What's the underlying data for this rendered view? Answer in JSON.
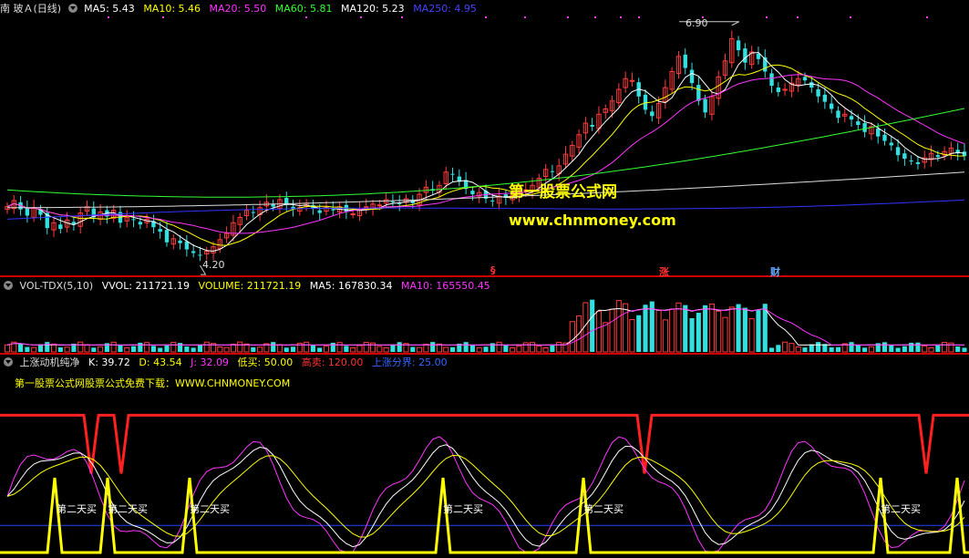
{
  "main_header": {
    "title": "南 玻Ａ(日线)",
    "ma": [
      {
        "label": "MA5: 5.43",
        "color": "#ffffff"
      },
      {
        "label": "MA10: 5.46",
        "color": "#ffff00"
      },
      {
        "label": "MA20: 5.50",
        "color": "#ff33ff"
      },
      {
        "label": "MA60: 5.81",
        "color": "#33ff33"
      },
      {
        "label": "MA120: 5.23",
        "color": "#ffffff"
      },
      {
        "label": "MA250: 4.95",
        "color": "#3333ff"
      }
    ]
  },
  "annotations": {
    "high": "6.90",
    "low": "4.20",
    "events": [
      {
        "text": "§",
        "color": "#ff3333"
      },
      {
        "text": "涨",
        "color": "#ff3333"
      },
      {
        "text": "财",
        "color": "#66aaff"
      }
    ]
  },
  "promo": {
    "line1": "第一股票公式网",
    "line2": "www.chnmoney.com"
  },
  "vol_header": {
    "title": "VOL-TDX(5,10)",
    "items": [
      {
        "label": "VVOL: 211721.19",
        "color": "#ffffff"
      },
      {
        "label": "VOLUME: 211721.19",
        "color": "#ffff00"
      },
      {
        "label": "MA5: 167830.34",
        "color": "#ffffff"
      },
      {
        "label": "MA10: 165550.45",
        "color": "#ff33ff"
      }
    ]
  },
  "kdj_header": {
    "title": "上涨动机纯净",
    "items": [
      {
        "label": "K: 39.72",
        "color": "#ffffff"
      },
      {
        "label": "D: 43.54",
        "color": "#ffff00"
      },
      {
        "label": "J: 32.09",
        "color": "#ff33ff"
      },
      {
        "label": "低买: 50.00",
        "color": "#ffff00"
      },
      {
        "label": "高卖: 120.00",
        "color": "#ff3333"
      },
      {
        "label": "上涨分界: 25.00",
        "color": "#3366ff"
      }
    ]
  },
  "kdj_note": "第一股票公式网股票公式免费下载：WWW.CHNMONEY.COM",
  "signal_label": "第二天买",
  "chart_data": [
    {
      "type": "candlestick",
      "title": "南 玻Ａ(日线)",
      "series": [
        {
          "name": "MA5",
          "value": 5.43,
          "color": "#ffffff"
        },
        {
          "name": "MA10",
          "value": 5.46,
          "color": "#ffff00"
        },
        {
          "name": "MA20",
          "value": 5.5,
          "color": "#ff33ff"
        },
        {
          "name": "MA60",
          "value": 5.81,
          "color": "#33ff33"
        },
        {
          "name": "MA120",
          "value": 5.23,
          "color": "#ffffff"
        },
        {
          "name": "MA250",
          "value": 4.95,
          "color": "#3333ff"
        }
      ],
      "max_price": 6.9,
      "min_price": 4.2,
      "closes": [
        4.86,
        4.93,
        4.83,
        4.76,
        4.85,
        4.77,
        4.62,
        4.68,
        4.61,
        4.71,
        4.66,
        4.79,
        4.86,
        4.74,
        4.8,
        4.75,
        4.82,
        4.68,
        4.74,
        4.71,
        4.66,
        4.72,
        4.63,
        4.58,
        4.46,
        4.5,
        4.45,
        4.38,
        4.34,
        4.31,
        4.36,
        4.41,
        4.49,
        4.56,
        4.68,
        4.74,
        4.82,
        4.79,
        4.85,
        4.91,
        4.86,
        4.94,
        4.88,
        4.83,
        4.85,
        4.9,
        4.84,
        4.79,
        4.85,
        4.82,
        4.86,
        4.8,
        4.78,
        4.83,
        4.86,
        4.89,
        4.88,
        4.94,
        4.92,
        4.89,
        4.95,
        4.9,
        5.0,
        5.08,
        5.04,
        5.1,
        5.25,
        5.22,
        5.14,
        5.06,
        5.0,
        5.02,
        4.95,
        4.92,
        4.98,
        4.96,
        4.99,
        5.02,
        5.05,
        5.1,
        5.18,
        5.28,
        5.25,
        5.32,
        5.45,
        5.55,
        5.67,
        5.8,
        5.76,
        5.9,
        5.96,
        6.05,
        6.18,
        6.3,
        6.28,
        6.1,
        5.95,
        5.88,
        6.02,
        6.2,
        6.38,
        6.55,
        6.42,
        6.25,
        6.05,
        5.92,
        6.1,
        6.32,
        6.5,
        6.75,
        6.62,
        6.48,
        6.6,
        6.52,
        6.38,
        6.22,
        6.15,
        6.18,
        6.25,
        6.3,
        6.28,
        6.2,
        6.1,
        6.04,
        5.96,
        5.86,
        5.9,
        5.84,
        5.78,
        5.7,
        5.76,
        5.65,
        5.6,
        5.55,
        5.44,
        5.4,
        5.38,
        5.34,
        5.41,
        5.46,
        5.42,
        5.48,
        5.52,
        5.46,
        5.43
      ],
      "volume_header": [
        "VVOL: 211721.19",
        "VOLUME: 211721.19",
        "MA5: 167830.34",
        "MA10: 165550.45"
      ]
    },
    {
      "type": "line",
      "title": "上涨动机纯净",
      "series": [
        {
          "name": "K",
          "value": 39.72,
          "color": "#ffffff"
        },
        {
          "name": "D",
          "value": 43.54,
          "color": "#ffff00"
        },
        {
          "name": "J",
          "value": 32.09,
          "color": "#ff33ff"
        }
      ],
      "reference_lines": [
        {
          "name": "低买",
          "value": 50.0
        },
        {
          "name": "高卖",
          "value": 120.0
        },
        {
          "name": "上涨分界",
          "value": 25.0
        }
      ]
    }
  ]
}
